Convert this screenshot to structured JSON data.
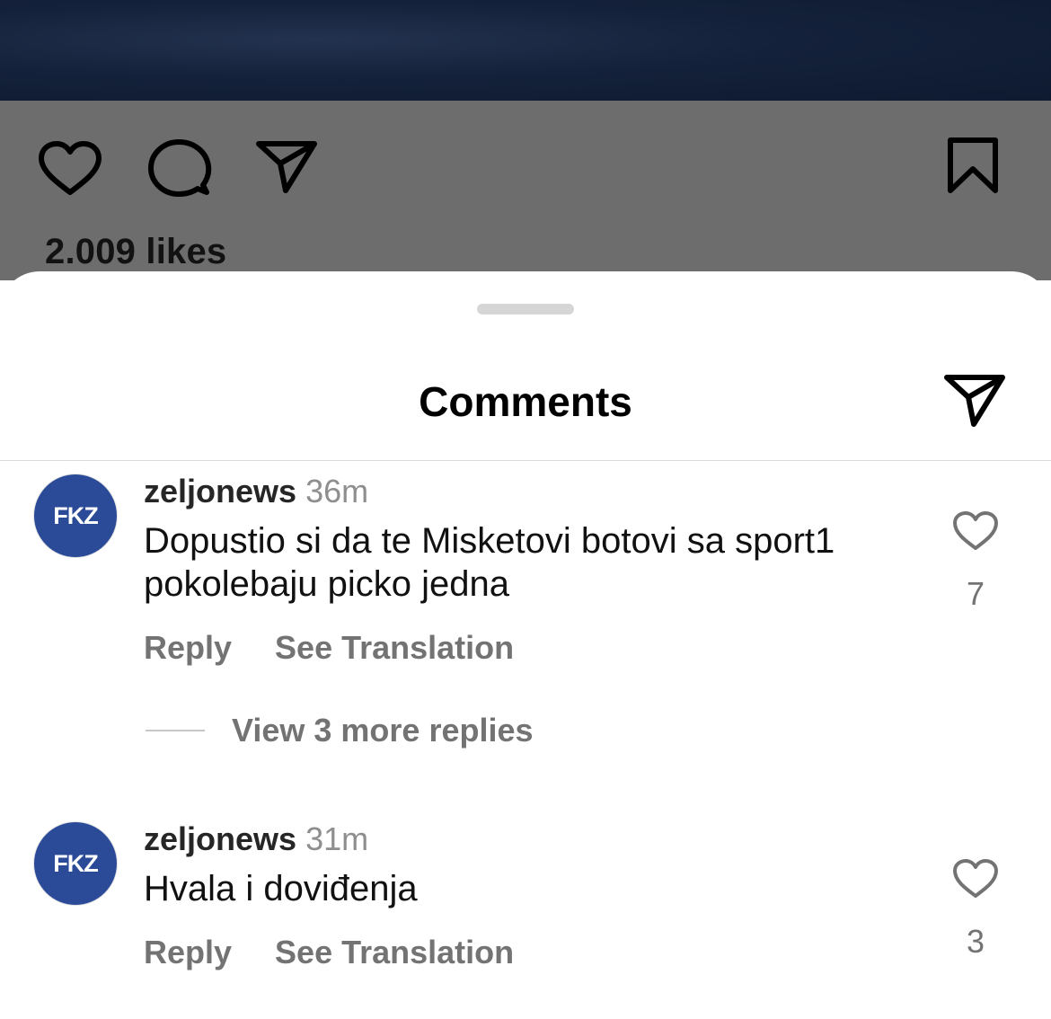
{
  "post": {
    "likes_text": "2.009 likes",
    "actions": [
      "heart-icon",
      "comment-icon",
      "share-icon",
      "bookmark-icon"
    ]
  },
  "sheet": {
    "title": "Comments",
    "share_icon": "send-icon"
  },
  "comments": [
    {
      "avatar_text": "FKZ",
      "username": "zeljonews",
      "time": "36m",
      "text": "Dopustio si da te Misketovi botovi sa sport1 pokolebaju picko jedna",
      "reply_label": "Reply",
      "translate_label": "See Translation",
      "like_count": "7",
      "more_replies": "View 3 more replies"
    },
    {
      "avatar_text": "FKZ",
      "username": "zeljonews",
      "time": "31m",
      "text": "Hvala i doviđenja",
      "reply_label": "Reply",
      "translate_label": "See Translation",
      "like_count": "3"
    }
  ],
  "colors": {
    "accent_avatar": "#2b4a97",
    "muted_text": "#737373",
    "dim_overlay": "#6d6d6d"
  }
}
